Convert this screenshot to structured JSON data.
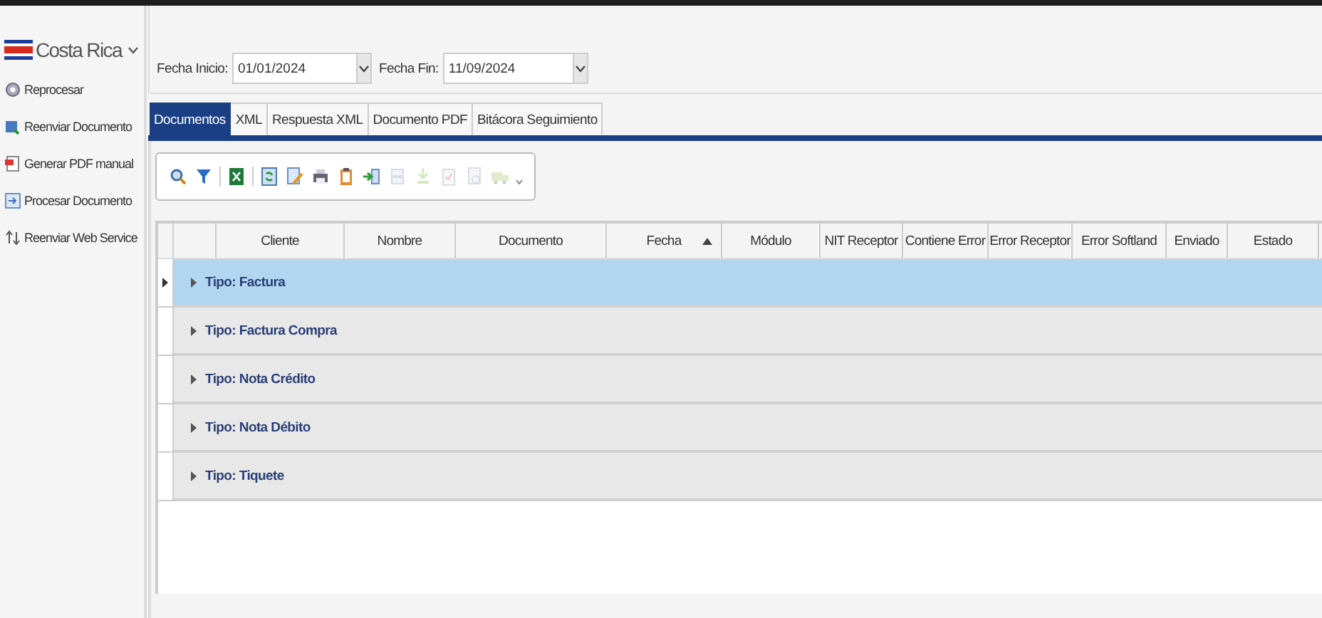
{
  "sidebar": {
    "country": "Costa Rica",
    "items": [
      {
        "label": "Reprocesar"
      },
      {
        "label": "Reenviar Documento"
      },
      {
        "label": "Generar PDF manual"
      },
      {
        "label": "Procesar Documento"
      },
      {
        "label": "Reenviar Web Service"
      }
    ]
  },
  "filters": [
    {
      "label": "Fecha Inicio:",
      "value": "01/01/2024"
    },
    {
      "label": "Fecha Fin:",
      "value": "11/09/2024"
    }
  ],
  "tabs": [
    {
      "label": "Documentos",
      "selected": true
    },
    {
      "label": "XML",
      "selected": false
    },
    {
      "label": "Respuesta XML",
      "selected": false
    },
    {
      "label": "Documento PDF",
      "selected": false
    },
    {
      "label": "Bitácora Seguimiento",
      "selected": false
    }
  ],
  "toolbar": [
    {
      "kind": "button",
      "disabled": false
    },
    {
      "kind": "button",
      "disabled": false
    },
    {
      "kind": "separator"
    },
    {
      "kind": "button",
      "disabled": false
    },
    {
      "kind": "separator"
    },
    {
      "kind": "button",
      "disabled": false
    },
    {
      "kind": "button",
      "disabled": false
    },
    {
      "kind": "button",
      "disabled": false
    },
    {
      "kind": "button",
      "disabled": false
    },
    {
      "kind": "button",
      "disabled": false
    },
    {
      "kind": "button",
      "disabled": true
    },
    {
      "kind": "button",
      "disabled": true
    },
    {
      "kind": "button",
      "disabled": true
    },
    {
      "kind": "button",
      "disabled": true
    },
    {
      "kind": "button",
      "disabled": true
    },
    {
      "kind": "more"
    }
  ],
  "table": {
    "columns": [
      {
        "label": "Cliente",
        "sorted": false
      },
      {
        "label": "Nombre",
        "sorted": false
      },
      {
        "label": "Documento",
        "sorted": false
      },
      {
        "label": "Fecha",
        "sorted": true
      },
      {
        "label": "Módulo",
        "sorted": false
      },
      {
        "label": "NIT Receptor",
        "sorted": false
      },
      {
        "label": "Contiene Error",
        "sorted": false
      },
      {
        "label": "Error Receptor",
        "sorted": false
      },
      {
        "label": "Error Softland",
        "sorted": false
      },
      {
        "label": "Enviado",
        "sorted": false
      },
      {
        "label": "Estado",
        "sorted": false
      }
    ],
    "groups": [
      {
        "label": "Tipo: Factura",
        "selected": true
      },
      {
        "label": "Tipo: Factura Compra",
        "selected": false
      },
      {
        "label": "Tipo: Nota Crédito",
        "selected": false
      },
      {
        "label": "Tipo: Nota Débito",
        "selected": false
      },
      {
        "label": "Tipo: Tiquete",
        "selected": false
      }
    ]
  }
}
